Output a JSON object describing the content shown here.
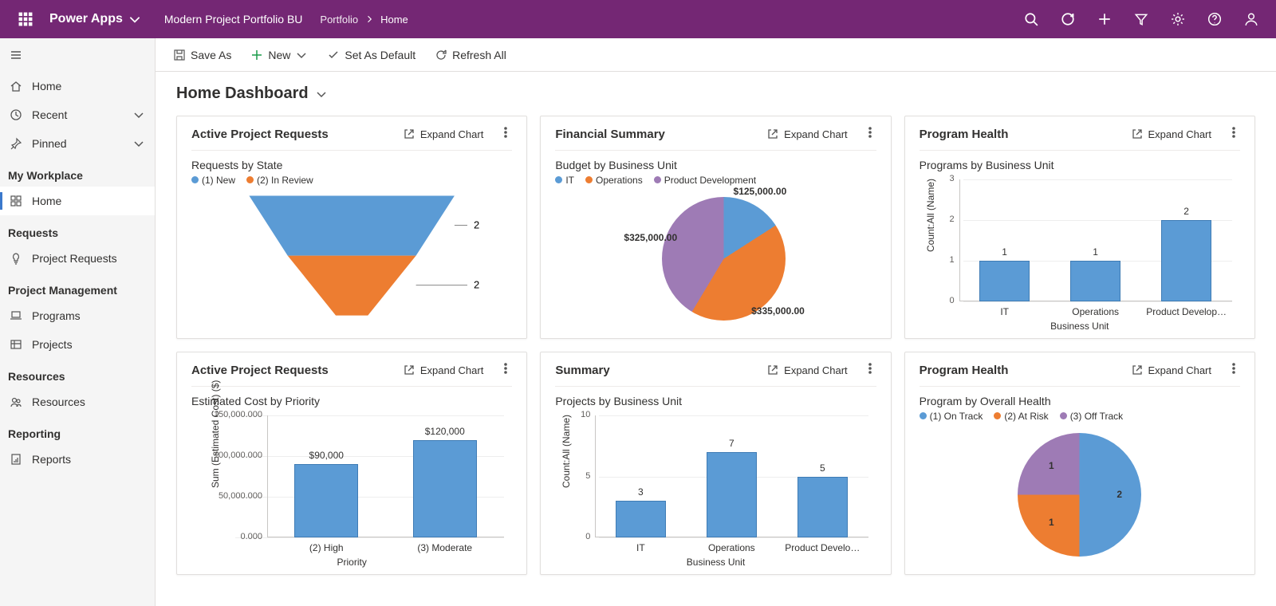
{
  "topbar": {
    "app_name": "Power Apps",
    "environment": "Modern Project Portfolio BU",
    "breadcrumb": [
      "Portfolio",
      "Home"
    ]
  },
  "commandbar": {
    "save_as": "Save As",
    "new": "New",
    "set_default": "Set As Default",
    "refresh_all": "Refresh All"
  },
  "page_title": "Home Dashboard",
  "leftnav": {
    "top": [
      {
        "label": "Home",
        "icon": "home"
      },
      {
        "label": "Recent",
        "icon": "clock",
        "expand": true
      },
      {
        "label": "Pinned",
        "icon": "pin",
        "expand": true
      }
    ],
    "groups": [
      {
        "title": "My Workplace",
        "items": [
          {
            "label": "Home",
            "icon": "grid",
            "active": true
          }
        ]
      },
      {
        "title": "Requests",
        "items": [
          {
            "label": "Project Requests",
            "icon": "bulb"
          }
        ]
      },
      {
        "title": "Project Management",
        "items": [
          {
            "label": "Programs",
            "icon": "laptop"
          },
          {
            "label": "Projects",
            "icon": "table"
          }
        ]
      },
      {
        "title": "Resources",
        "items": [
          {
            "label": "Resources",
            "icon": "people"
          }
        ]
      },
      {
        "title": "Reporting",
        "items": [
          {
            "label": "Reports",
            "icon": "report"
          }
        ]
      }
    ]
  },
  "cards": [
    {
      "title": "Active Project Requests",
      "subtitle": "Requests by State",
      "expand": "Expand Chart",
      "legend": [
        {
          "label": "(1) New",
          "color": "#5b9bd5"
        },
        {
          "label": "(2) In Review",
          "color": "#ed7d31"
        }
      ]
    },
    {
      "title": "Financial Summary",
      "subtitle": "Budget by Business Unit",
      "expand": "Expand Chart",
      "legend": [
        {
          "label": "IT",
          "color": "#5b9bd5"
        },
        {
          "label": "Operations",
          "color": "#ed7d31"
        },
        {
          "label": "Product Development",
          "color": "#9e7bb5"
        }
      ]
    },
    {
      "title": "Program Health",
      "subtitle": "Programs by Business Unit",
      "expand": "Expand Chart",
      "xlabel": "Business Unit",
      "ylabel": "Count:All (Name)"
    },
    {
      "title": "Active Project Requests",
      "subtitle": "Estimated Cost by Priority",
      "expand": "Expand Chart",
      "xlabel": "Priority",
      "ylabel": "Sum (Estimated Cost) ($)"
    },
    {
      "title": "Summary",
      "subtitle": "Projects by Business Unit",
      "expand": "Expand Chart",
      "xlabel": "Business Unit",
      "ylabel": "Count:All (Name)"
    },
    {
      "title": "Program Health",
      "subtitle": "Program by Overall Health",
      "expand": "Expand Chart",
      "legend": [
        {
          "label": "(1) On Track",
          "color": "#5b9bd5"
        },
        {
          "label": "(2) At Risk",
          "color": "#ed7d31"
        },
        {
          "label": "(3) Off Track",
          "color": "#9e7bb5"
        }
      ]
    }
  ],
  "chart_data": [
    {
      "type": "funnel",
      "title": "Requests by State",
      "series": [
        {
          "name": "(1) New",
          "value": 2,
          "color": "#5b9bd5"
        },
        {
          "name": "(2) In Review",
          "value": 2,
          "color": "#ed7d31"
        }
      ]
    },
    {
      "type": "pie",
      "title": "Budget by Business Unit",
      "slices": [
        {
          "name": "IT",
          "value": 125000,
          "label": "$125,000.00",
          "color": "#5b9bd5"
        },
        {
          "name": "Operations",
          "value": 335000,
          "label": "$335,000.00",
          "color": "#ed7d31"
        },
        {
          "name": "Product Development",
          "value": 325000,
          "label": "$325,000.00",
          "color": "#9e7bb5"
        }
      ]
    },
    {
      "type": "bar",
      "title": "Programs by Business Unit",
      "categories": [
        "IT",
        "Operations",
        "Product Develop…"
      ],
      "values": [
        1,
        1,
        2
      ],
      "ylabel": "Count:All (Name)",
      "xlabel": "Business Unit",
      "yticks": [
        0,
        1,
        2,
        3
      ],
      "ylim": [
        0,
        3
      ]
    },
    {
      "type": "bar",
      "title": "Estimated Cost by Priority",
      "categories": [
        "(2) High",
        "(3) Moderate"
      ],
      "values": [
        90000,
        120000
      ],
      "labels": [
        "$90,000",
        "$120,000"
      ],
      "ylabel": "Sum (Estimated Cost) ($)",
      "xlabel": "Priority",
      "yticks": [
        0,
        50000,
        100000,
        150000
      ],
      "ytick_labels": [
        "0.000",
        "50,000.000",
        "100,000.000",
        "150,000.000"
      ],
      "ylim": [
        0,
        150000
      ]
    },
    {
      "type": "bar",
      "title": "Projects by Business Unit",
      "categories": [
        "IT",
        "Operations",
        "Product Develo…"
      ],
      "values": [
        3,
        7,
        5
      ],
      "ylabel": "Count:All (Name)",
      "xlabel": "Business Unit",
      "yticks": [
        0,
        5,
        10
      ],
      "ylim": [
        0,
        10
      ]
    },
    {
      "type": "pie",
      "title": "Program by Overall Health",
      "slices": [
        {
          "name": "(1) On Track",
          "value": 2,
          "label": "2",
          "color": "#5b9bd5"
        },
        {
          "name": "(2) At Risk",
          "value": 1,
          "label": "1",
          "color": "#ed7d31"
        },
        {
          "name": "(3) Off Track",
          "value": 1,
          "label": "1",
          "color": "#9e7bb5"
        }
      ]
    }
  ]
}
